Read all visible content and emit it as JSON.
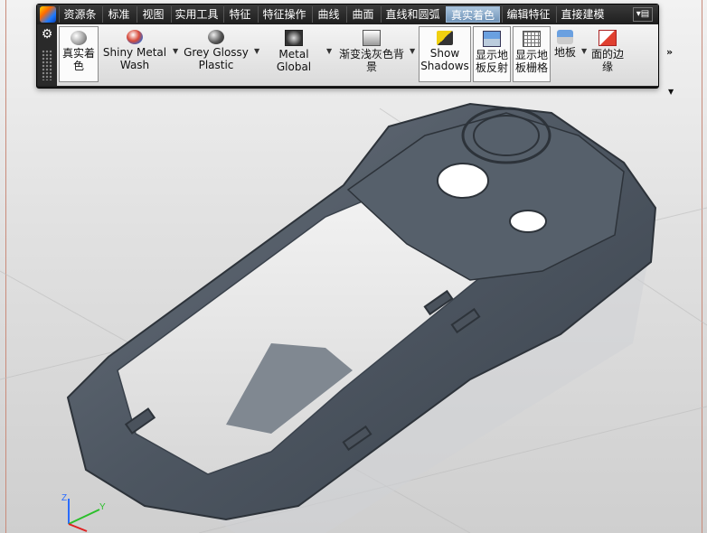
{
  "tabs": [
    {
      "label": "资源条"
    },
    {
      "label": "标准"
    },
    {
      "label": "视图"
    },
    {
      "label": "实用工具"
    },
    {
      "label": "特征"
    },
    {
      "label": "特征操作"
    },
    {
      "label": "曲线"
    },
    {
      "label": "曲面"
    },
    {
      "label": "直线和圆弧"
    },
    {
      "label": "真实着色",
      "active": true
    },
    {
      "label": "编辑特征"
    },
    {
      "label": "直接建模"
    }
  ],
  "tools": [
    {
      "label1": "真实着",
      "label2": "色",
      "icon": "sphere-shading-icon"
    },
    {
      "label1": "Shiny Metal",
      "label2": "Wash",
      "icon": "shiny-metal-icon"
    },
    {
      "label1": "Grey Glossy",
      "label2": "Plastic",
      "icon": "grey-glossy-icon"
    },
    {
      "label1": "Metal",
      "label2": "Global",
      "icon": "metal-global-icon"
    },
    {
      "label1": "渐变浅灰色背",
      "label2": "景",
      "icon": "gradient-background-icon"
    },
    {
      "label1": "Show",
      "label2": "Shadows",
      "icon": "show-shadows-icon"
    },
    {
      "label1": "显示地",
      "label2": "板反射",
      "icon": "floor-reflection-icon"
    },
    {
      "label1": "显示地",
      "label2": "板栅格",
      "icon": "floor-grid-icon"
    },
    {
      "label1": "地板",
      "label2": "",
      "icon": "floor-icon"
    },
    {
      "label1": "面的边",
      "label2": "缘",
      "icon": "face-edges-icon"
    }
  ],
  "axes": {
    "z": "Z",
    "y": "Y"
  },
  "colors": {
    "ribbon_bg": "#1d1d1d",
    "active_tab": "#6f93b8",
    "model": "#5c6570"
  }
}
